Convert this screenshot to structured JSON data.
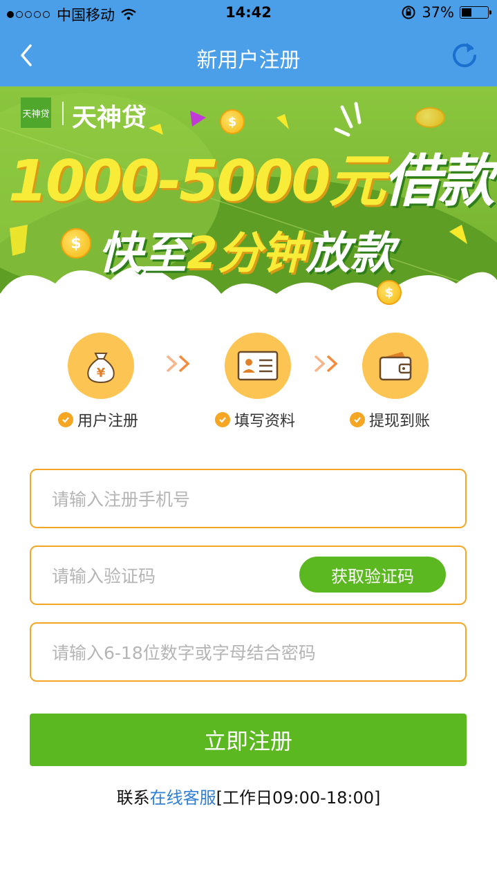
{
  "status_bar": {
    "carrier": "中国移动",
    "time": "14:42",
    "battery": "37%",
    "battery_level": 0.37,
    "signal_bars": 1
  },
  "nav": {
    "title": "新用户注册",
    "back_icon": "chevron-left-icon",
    "refresh_icon": "refresh-icon"
  },
  "banner": {
    "logo_small": "天神贷",
    "logo_text": "天神贷",
    "line1_main": "1000-5000元",
    "line1_accent": "借款",
    "line2_main": "快至",
    "line2_accent": "2分钟",
    "line2_end": "放款"
  },
  "steps": [
    {
      "label": "用户注册",
      "icon": "money-bag-icon"
    },
    {
      "label": "填写资料",
      "icon": "id-card-icon"
    },
    {
      "label": "提现到账",
      "icon": "wallet-icon"
    }
  ],
  "form": {
    "phone_placeholder": "请输入注册手机号",
    "code_placeholder": "请输入验证码",
    "get_code_label": "获取验证码",
    "password_placeholder": "请输入6-18位数字或字母结合密码",
    "submit_label": "立即注册"
  },
  "contact": {
    "prefix": "联系",
    "link": "在线客服",
    "hours": "[工作日09:00-18:00]"
  },
  "colors": {
    "nav_blue": "#4a9fe8",
    "green": "#5cb820",
    "orange_border": "#f5a623",
    "step_circle": "#fcc553",
    "link_blue": "#2f7fd6"
  }
}
